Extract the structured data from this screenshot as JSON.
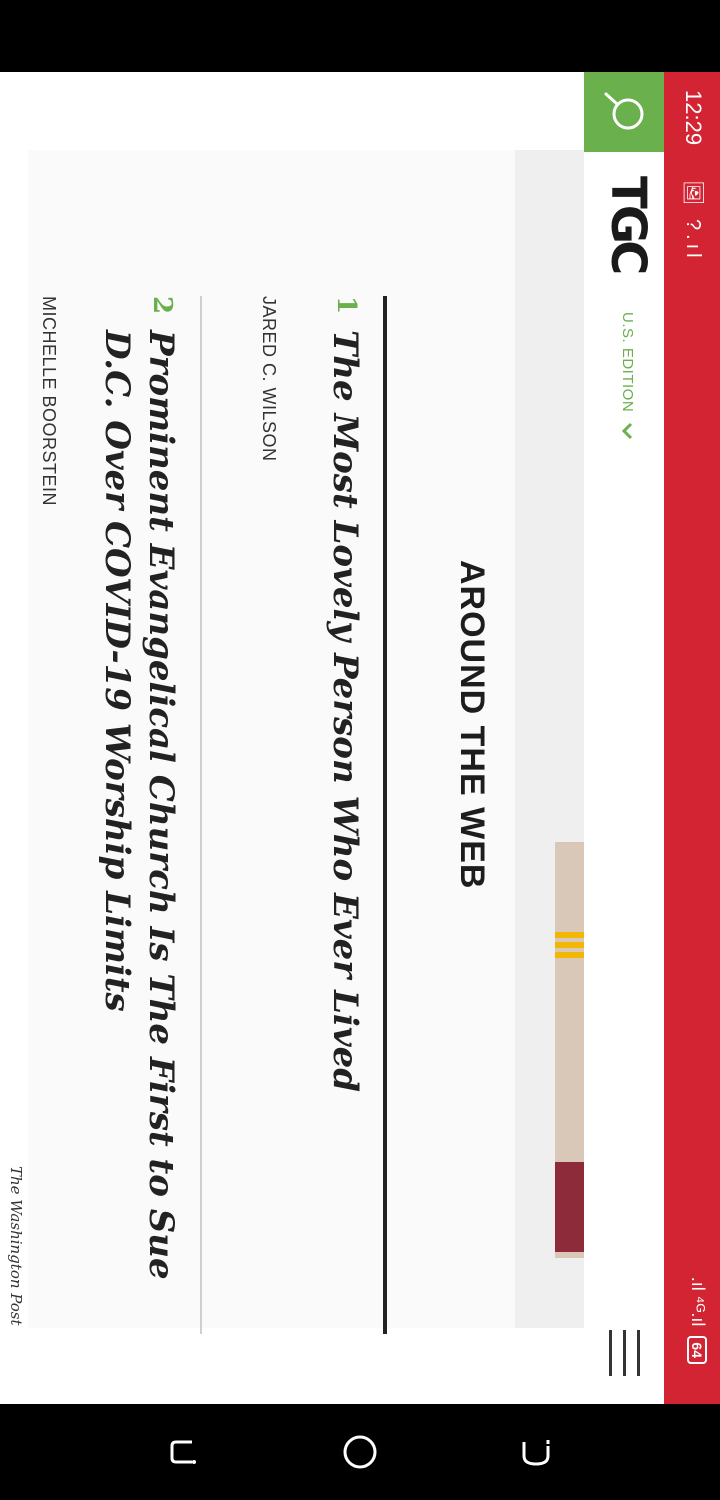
{
  "status_bar": {
    "time": "12:29",
    "left_icons": "🖼 ?.ıl",
    "signal": ".ıl ⁴ᴳ.ıl",
    "battery": "64"
  },
  "header": {
    "logo": "TGC",
    "edition": "U.S. EDITION"
  },
  "section": {
    "title": "AROUND THE WEB",
    "items": [
      {
        "num": "1",
        "title": "The Most Lovely Person Who Ever Lived",
        "author": "JARED C. WILSON"
      },
      {
        "num": "2",
        "title": "Prominent Evangelical Church Is The First to Sue D.C. Over COVID-19 Worship Limits",
        "author": "MICHELLE BOORSTEIN",
        "source": "The Washington Post"
      }
    ]
  },
  "colors": {
    "accent": "#6ab04c",
    "status": "#d22433"
  },
  "icons": {
    "search": "search-icon",
    "menu": "hamburger-menu-icon",
    "chevron": "chevron-down-icon"
  }
}
